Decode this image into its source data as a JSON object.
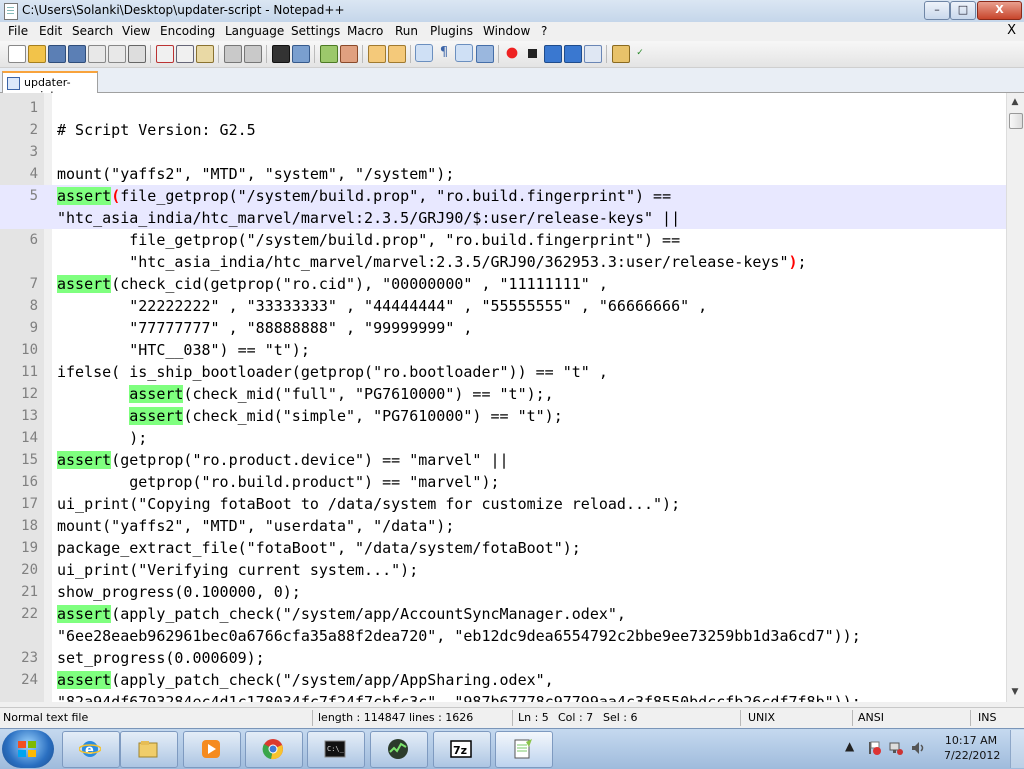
{
  "window": {
    "title": "C:\\Users\\Solanki\\Desktop\\updater-script - Notepad++",
    "min_glyph": "–",
    "max_glyph": "□",
    "close_glyph": "X"
  },
  "menu": {
    "items": [
      "File",
      "Edit",
      "Search",
      "View",
      "Encoding",
      "Language",
      "Settings",
      "Macro",
      "Run",
      "Plugins",
      "Window",
      "?"
    ],
    "close_label": "X"
  },
  "tab": {
    "label": "updater-script"
  },
  "editor": {
    "lines": [
      {
        "n": "1",
        "t": ""
      },
      {
        "n": "2",
        "t": "# Script Version: G2.5"
      },
      {
        "n": "3",
        "t": ""
      },
      {
        "n": "4",
        "t": "mount(\"yaffs2\", \"MTD\", \"system\", \"/system\");"
      },
      {
        "n": "5",
        "hl": "assert",
        "br": "(",
        "t": "file_getprop(\"/system/build.prop\", \"ro.build.fingerprint\") ==",
        "cur": true
      },
      {
        "n": "",
        "t": "\"htc_asia_india/htc_marvel/marvel:2.3.5/GRJ90/$:user/release-keys\" ||",
        "cur": true
      },
      {
        "n": "6",
        "t": "        file_getprop(\"/system/build.prop\", \"ro.build.fingerprint\") =="
      },
      {
        "n": "",
        "t": "        \"htc_asia_india/htc_marvel/marvel:2.3.5/GRJ90/362953.3:user/release-keys\"",
        "tail": ")",
        "end": ";"
      },
      {
        "n": "7",
        "hl": "assert",
        "t": "(check_cid(getprop(\"ro.cid\"), \"00000000\" , \"11111111\" ,"
      },
      {
        "n": "8",
        "t": "        \"22222222\" , \"33333333\" , \"44444444\" , \"55555555\" , \"66666666\" ,"
      },
      {
        "n": "9",
        "t": "        \"77777777\" , \"88888888\" , \"99999999\" ,"
      },
      {
        "n": "10",
        "t": "        \"HTC__038\") == \"t\");"
      },
      {
        "n": "11",
        "t": "ifelse( is_ship_bootloader(getprop(\"ro.bootloader\")) == \"t\" ,"
      },
      {
        "n": "12",
        "pre": "        ",
        "hl": "assert",
        "t": "(check_mid(\"full\", \"PG7610000\") == \"t\");,"
      },
      {
        "n": "13",
        "pre": "        ",
        "hl": "assert",
        "t": "(check_mid(\"simple\", \"PG7610000\") == \"t\");"
      },
      {
        "n": "14",
        "t": "        );"
      },
      {
        "n": "15",
        "hl": "assert",
        "t": "(getprop(\"ro.product.device\") == \"marvel\" ||"
      },
      {
        "n": "16",
        "t": "        getprop(\"ro.build.product\") == \"marvel\");"
      },
      {
        "n": "17",
        "t": "ui_print(\"Copying fotaBoot to /data/system for customize reload...\");"
      },
      {
        "n": "18",
        "t": "mount(\"yaffs2\", \"MTD\", \"userdata\", \"/data\");"
      },
      {
        "n": "19",
        "t": "package_extract_file(\"fotaBoot\", \"/data/system/fotaBoot\");"
      },
      {
        "n": "20",
        "t": "ui_print(\"Verifying current system...\");"
      },
      {
        "n": "21",
        "t": "show_progress(0.100000, 0);"
      },
      {
        "n": "22",
        "hl": "assert",
        "t": "(apply_patch_check(\"/system/app/AccountSyncManager.odex\","
      },
      {
        "n": "",
        "t": "\"6ee28eaeb962961bec0a6766cfa35a88f2dea720\", \"eb12dc9dea6554792c2bbe9ee73259bb1d3a6cd7\"));"
      },
      {
        "n": "23",
        "t": "set_progress(0.000609);"
      },
      {
        "n": "24",
        "hl": "assert",
        "t": "(apply_patch_check(\"/system/app/AppSharing.odex\","
      },
      {
        "n": "",
        "t": "\"82a94df6793284ec4d1c178034fc7f24f7cbfc3c\", \"987b67778c97799aa4c3f8550bdccfb26cdf7f8b\"));"
      }
    ]
  },
  "status": {
    "type": "Normal text file",
    "length": "length : 114847",
    "lines": "lines : 1626",
    "ln": "Ln : 5",
    "col": "Col : 7",
    "sel": "Sel : 6",
    "eol": "UNIX",
    "encoding": "ANSI",
    "mode": "INS"
  },
  "taskbar": {
    "buttons": [
      "internet-explorer",
      "libraries",
      "media-player",
      "chrome",
      "command-prompt",
      "activity-monitor",
      "7zip",
      "notepad-plus-plus"
    ],
    "tray_glyph": "▲",
    "time": "10:17 AM",
    "date": "7/22/2012"
  },
  "colors": {
    "assert_highlight": "#7fff7f",
    "current_line": "#e8e8ff",
    "brace_match": "#ff0000"
  }
}
